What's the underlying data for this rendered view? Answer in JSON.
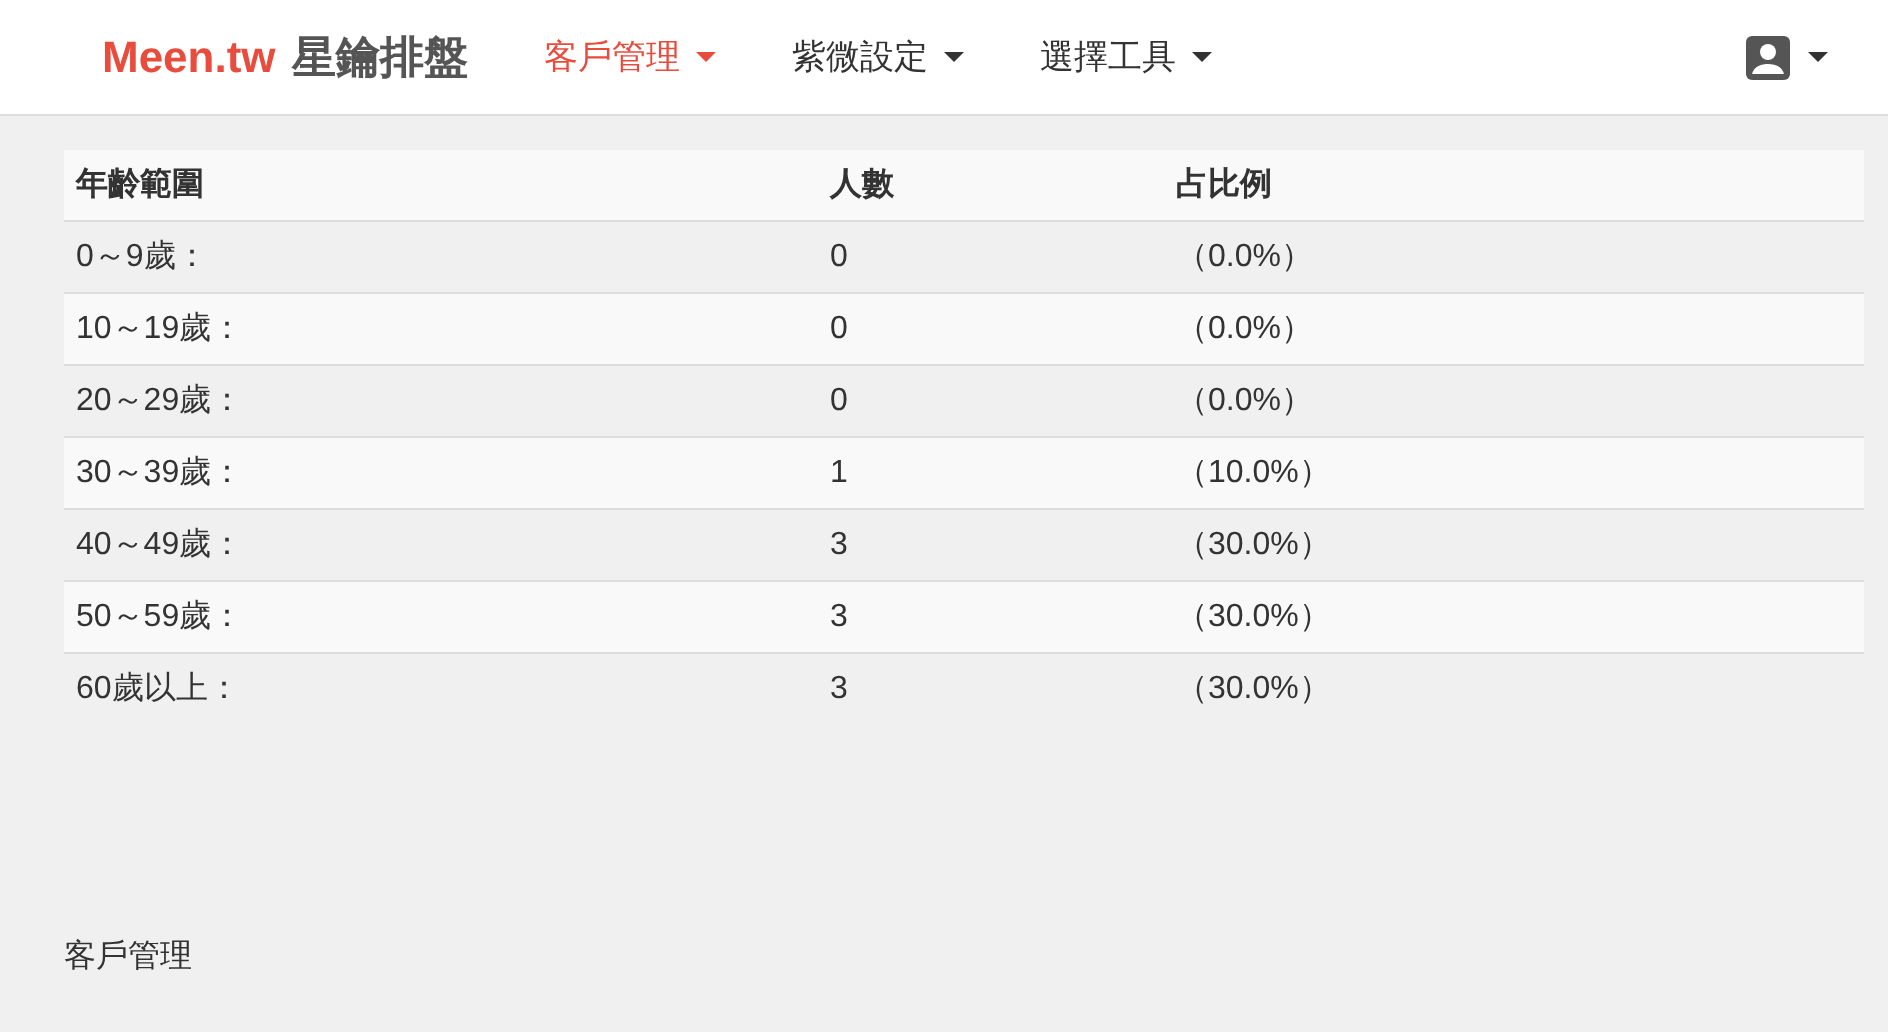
{
  "navbar": {
    "brand": {
      "logo": "Meen.tw",
      "name": "星鑰排盤"
    },
    "menus": [
      {
        "label": "客戶管理",
        "selected": true
      },
      {
        "label": "紫微設定",
        "selected": false
      },
      {
        "label": "選擇工具",
        "selected": false
      }
    ]
  },
  "table": {
    "columns": [
      "年齡範圍",
      "人數",
      "占比例"
    ],
    "rows": [
      [
        "0～9歲：",
        "0",
        "（0.0%）"
      ],
      [
        "10～19歲：",
        "0",
        "（0.0%）"
      ],
      [
        "20～29歲：",
        "0",
        "（0.0%）"
      ],
      [
        "30～39歲：",
        "1",
        "（10.0%）"
      ],
      [
        "40～49歲：",
        "3",
        "（30.0%）"
      ],
      [
        "50～59歲：",
        "3",
        "（30.0%）"
      ],
      [
        "60歲以上：",
        "3",
        "（30.0%）"
      ]
    ]
  },
  "footer": "客戶管理"
}
